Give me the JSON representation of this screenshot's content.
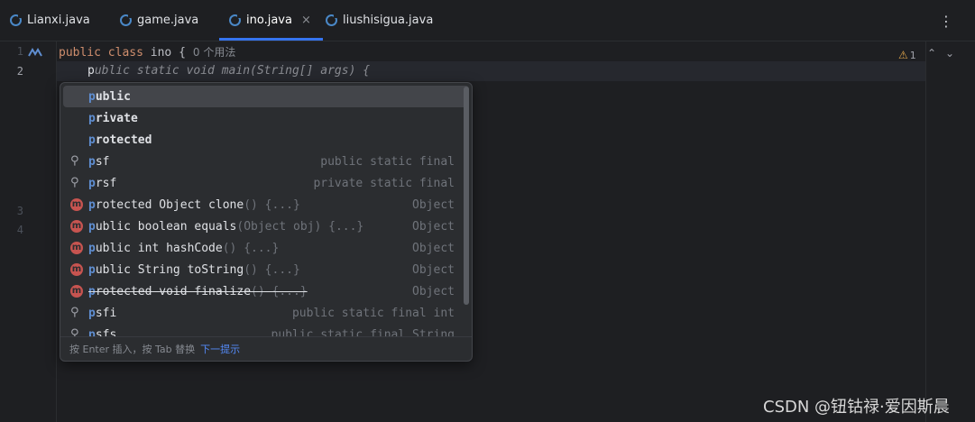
{
  "tabs": [
    {
      "label": "Lianxi.java",
      "icon": "java-class-icon"
    },
    {
      "label": "game.java",
      "icon": "java-class-icon"
    },
    {
      "label": "ino.java",
      "icon": "java-class-icon",
      "active": true,
      "close": "×"
    },
    {
      "label": "liushisigua.java",
      "icon": "java-class-icon"
    }
  ],
  "menu_icon": "⋮",
  "gutter": {
    "lines": [
      "1",
      "2",
      "3",
      "4"
    ]
  },
  "code": {
    "line1_public": "public",
    "line1_class": "class",
    "line1_name": "ino {",
    "line1_usages": "0 个用法",
    "line2_typed": "p",
    "line2_rest": "ublic static void main(String[] args) {"
  },
  "inspections": {
    "warning_count": "1",
    "up": "⌃",
    "down": "⌄"
  },
  "completion": {
    "items": [
      {
        "match": "p",
        "rest": "ublic",
        "right": "",
        "icon": "keyword"
      },
      {
        "match": "p",
        "rest": "rivate",
        "right": "",
        "icon": "keyword"
      },
      {
        "match": "p",
        "rest": "rotected",
        "right": "",
        "icon": "keyword"
      },
      {
        "match": "p",
        "rest": "sf",
        "right": "public static final",
        "icon": "template-icon"
      },
      {
        "match": "p",
        "rest": "rsf",
        "right": "private static final",
        "icon": "template-icon"
      },
      {
        "match": "p",
        "rest": "rotected Object clone",
        "params": "() {...}",
        "right": "Object",
        "icon": "method-icon"
      },
      {
        "match": "p",
        "rest": "ublic boolean equals",
        "params": "(Object obj) {...}",
        "right": "Object",
        "icon": "method-icon"
      },
      {
        "match": "p",
        "rest": "ublic int hashCode",
        "params": "() {...}",
        "right": "Object",
        "icon": "method-icon"
      },
      {
        "match": "p",
        "rest": "ublic String toString",
        "params": "() {...}",
        "right": "Object",
        "icon": "method-icon"
      },
      {
        "match": "p",
        "rest": "rotected void finalize",
        "params": "() {...}",
        "right": "Object",
        "icon": "method-icon",
        "deprecated": true
      },
      {
        "match": "p",
        "rest": "sfi",
        "right": "public static final int",
        "icon": "template-icon"
      },
      {
        "match": "p",
        "rest": "sfs",
        "right": "public static final String",
        "icon": "template-icon"
      }
    ],
    "footer_hint": "按 Enter 插入，按 Tab 替换",
    "footer_link": "下一提示"
  },
  "watermark": "CSDN @钮钴禄·爱因斯晨"
}
